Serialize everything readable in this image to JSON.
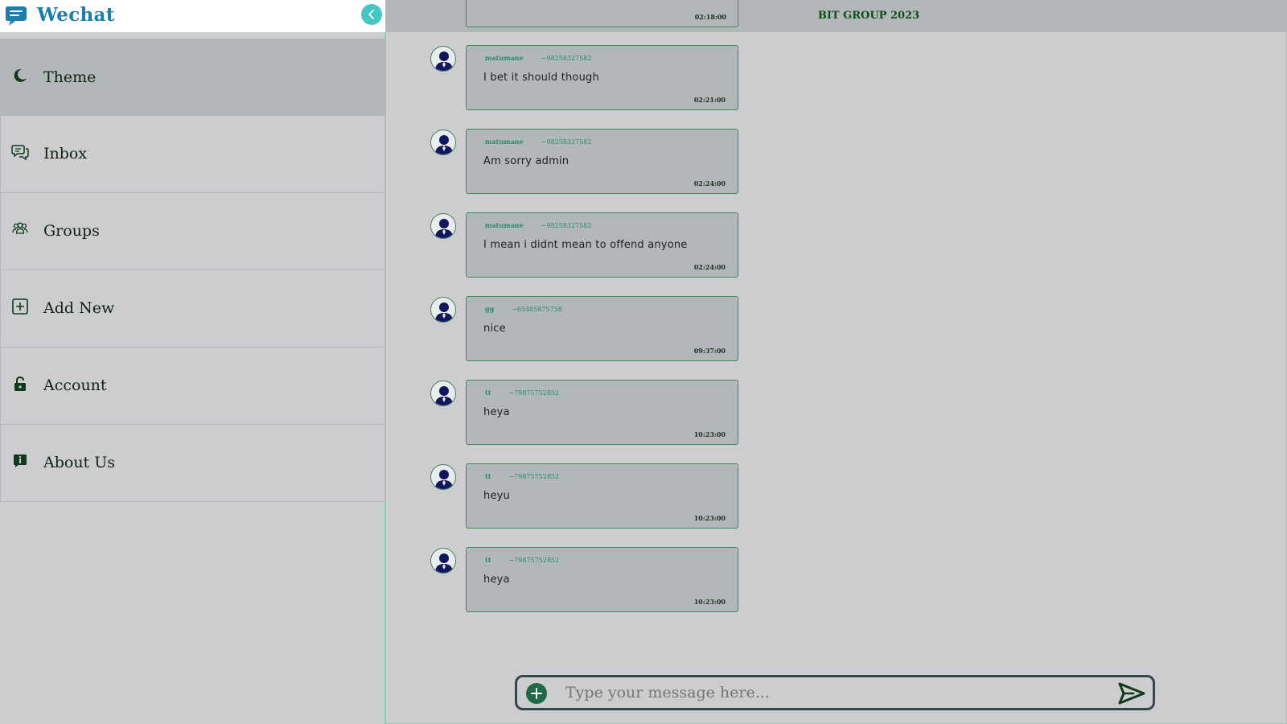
{
  "app": {
    "title": "Wechat"
  },
  "sidebar": {
    "items": [
      {
        "label": "Theme",
        "icon": "moon-icon",
        "active": true
      },
      {
        "label": "Inbox",
        "icon": "chat-bubbles-icon",
        "active": false
      },
      {
        "label": "Groups",
        "icon": "people-group-icon",
        "active": false
      },
      {
        "label": "Add New",
        "icon": "plus-square-icon",
        "active": false
      },
      {
        "label": "Account",
        "icon": "unlock-icon",
        "active": false
      },
      {
        "label": "About Us",
        "icon": "info-icon",
        "active": false
      }
    ]
  },
  "chat": {
    "header_title": "BIT GROUP 2023",
    "partial_time": "02:18:00",
    "messages": [
      {
        "sender": "matumane",
        "phone": "~98258327582",
        "text": "I bet it should though",
        "time": "02:21:00"
      },
      {
        "sender": "matumane",
        "phone": "~98258327582",
        "text": "Am sorry admin",
        "time": "02:24:00"
      },
      {
        "sender": "matumane",
        "phone": "~98258327582",
        "text": "I mean i didnt mean to offend anyone",
        "time": "02:24:00"
      },
      {
        "sender": "gg",
        "phone": "~65485875758",
        "text": "nice",
        "time": "09:37:00"
      },
      {
        "sender": "tt",
        "phone": "~79875752852",
        "text": "heya",
        "time": "10:23:00"
      },
      {
        "sender": "tt",
        "phone": "~79875752852",
        "text": "heyu",
        "time": "10:23:00"
      },
      {
        "sender": "tt",
        "phone": "~79875752852",
        "text": "heya",
        "time": "10:23:00"
      }
    ]
  },
  "composer": {
    "placeholder": "Type your message here...",
    "value": ""
  },
  "colors": {
    "brand": "#1a7fb0",
    "accent": "#43c7c2",
    "bubble": "#b2b8b9",
    "icon_dark": "#0f3a1c"
  }
}
